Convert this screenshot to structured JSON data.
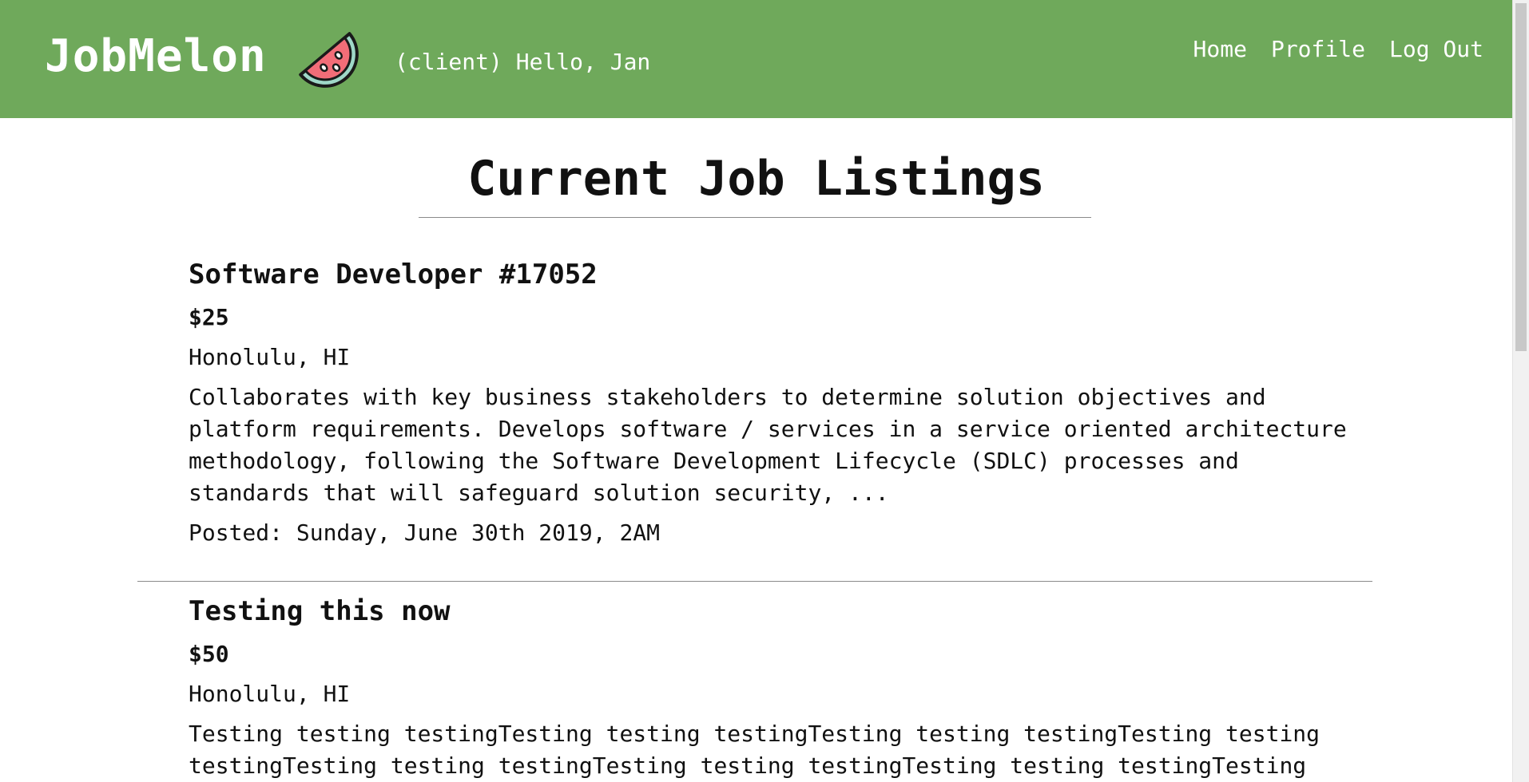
{
  "header": {
    "brand": "JobMelon",
    "greeting": "(client) Hello, Jan",
    "nav": [
      {
        "label": "Home"
      },
      {
        "label": "Profile"
      },
      {
        "label": "Log Out"
      }
    ],
    "colors": {
      "background": "#6fa95b",
      "text": "#ffffff"
    }
  },
  "main": {
    "title": "Current Job Listings",
    "jobs": [
      {
        "title": "Software Developer #17052",
        "pay": "$25",
        "location": "Honolulu, HI",
        "description": "Collaborates with key business stakeholders to determine solution objectives and platform requirements. Develops software / services in a service oriented architecture methodology, following the Software Development Lifecycle (SDLC) processes and standards that will safeguard solution security, ...",
        "posted": "Posted: Sunday, June 30th 2019, 2AM"
      },
      {
        "title": "Testing this now",
        "pay": "$50",
        "location": "Honolulu, HI",
        "description": "Testing testing testingTesting testing testingTesting testing testingTesting testing testingTesting testing testingTesting testing testingTesting testing testingTesting"
      }
    ]
  },
  "icons": {
    "logo": "watermelon-slice-icon"
  }
}
